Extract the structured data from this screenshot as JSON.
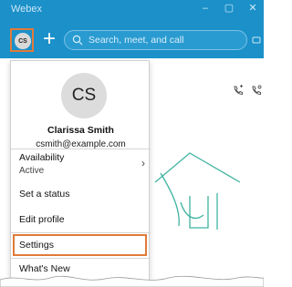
{
  "app": {
    "title": "Webex"
  },
  "window_controls": {
    "minimize": "–",
    "maximize": "▢",
    "close": "✕"
  },
  "toolbar": {
    "avatar_initials": "CS",
    "search_placeholder": "Search, meet, and call"
  },
  "profile": {
    "initials": "CS",
    "name": "Clarissa Smith",
    "email": "csmith@example.com"
  },
  "menu": {
    "availability_label": "Availability",
    "availability_status": "Active",
    "chevron": "›",
    "set_status": "Set a status",
    "edit_profile": "Edit profile",
    "settings": "Settings",
    "whats_new": "What's New"
  },
  "colors": {
    "titlebar": "#1b90c9",
    "highlight": "#e07b39",
    "illustration": "#3fb3a0"
  },
  "icons": {
    "search": "search-icon",
    "plus": "plus-icon",
    "call": "call-icon",
    "call_settings": "call-settings-icon",
    "chevron": "chevron-right-icon"
  }
}
